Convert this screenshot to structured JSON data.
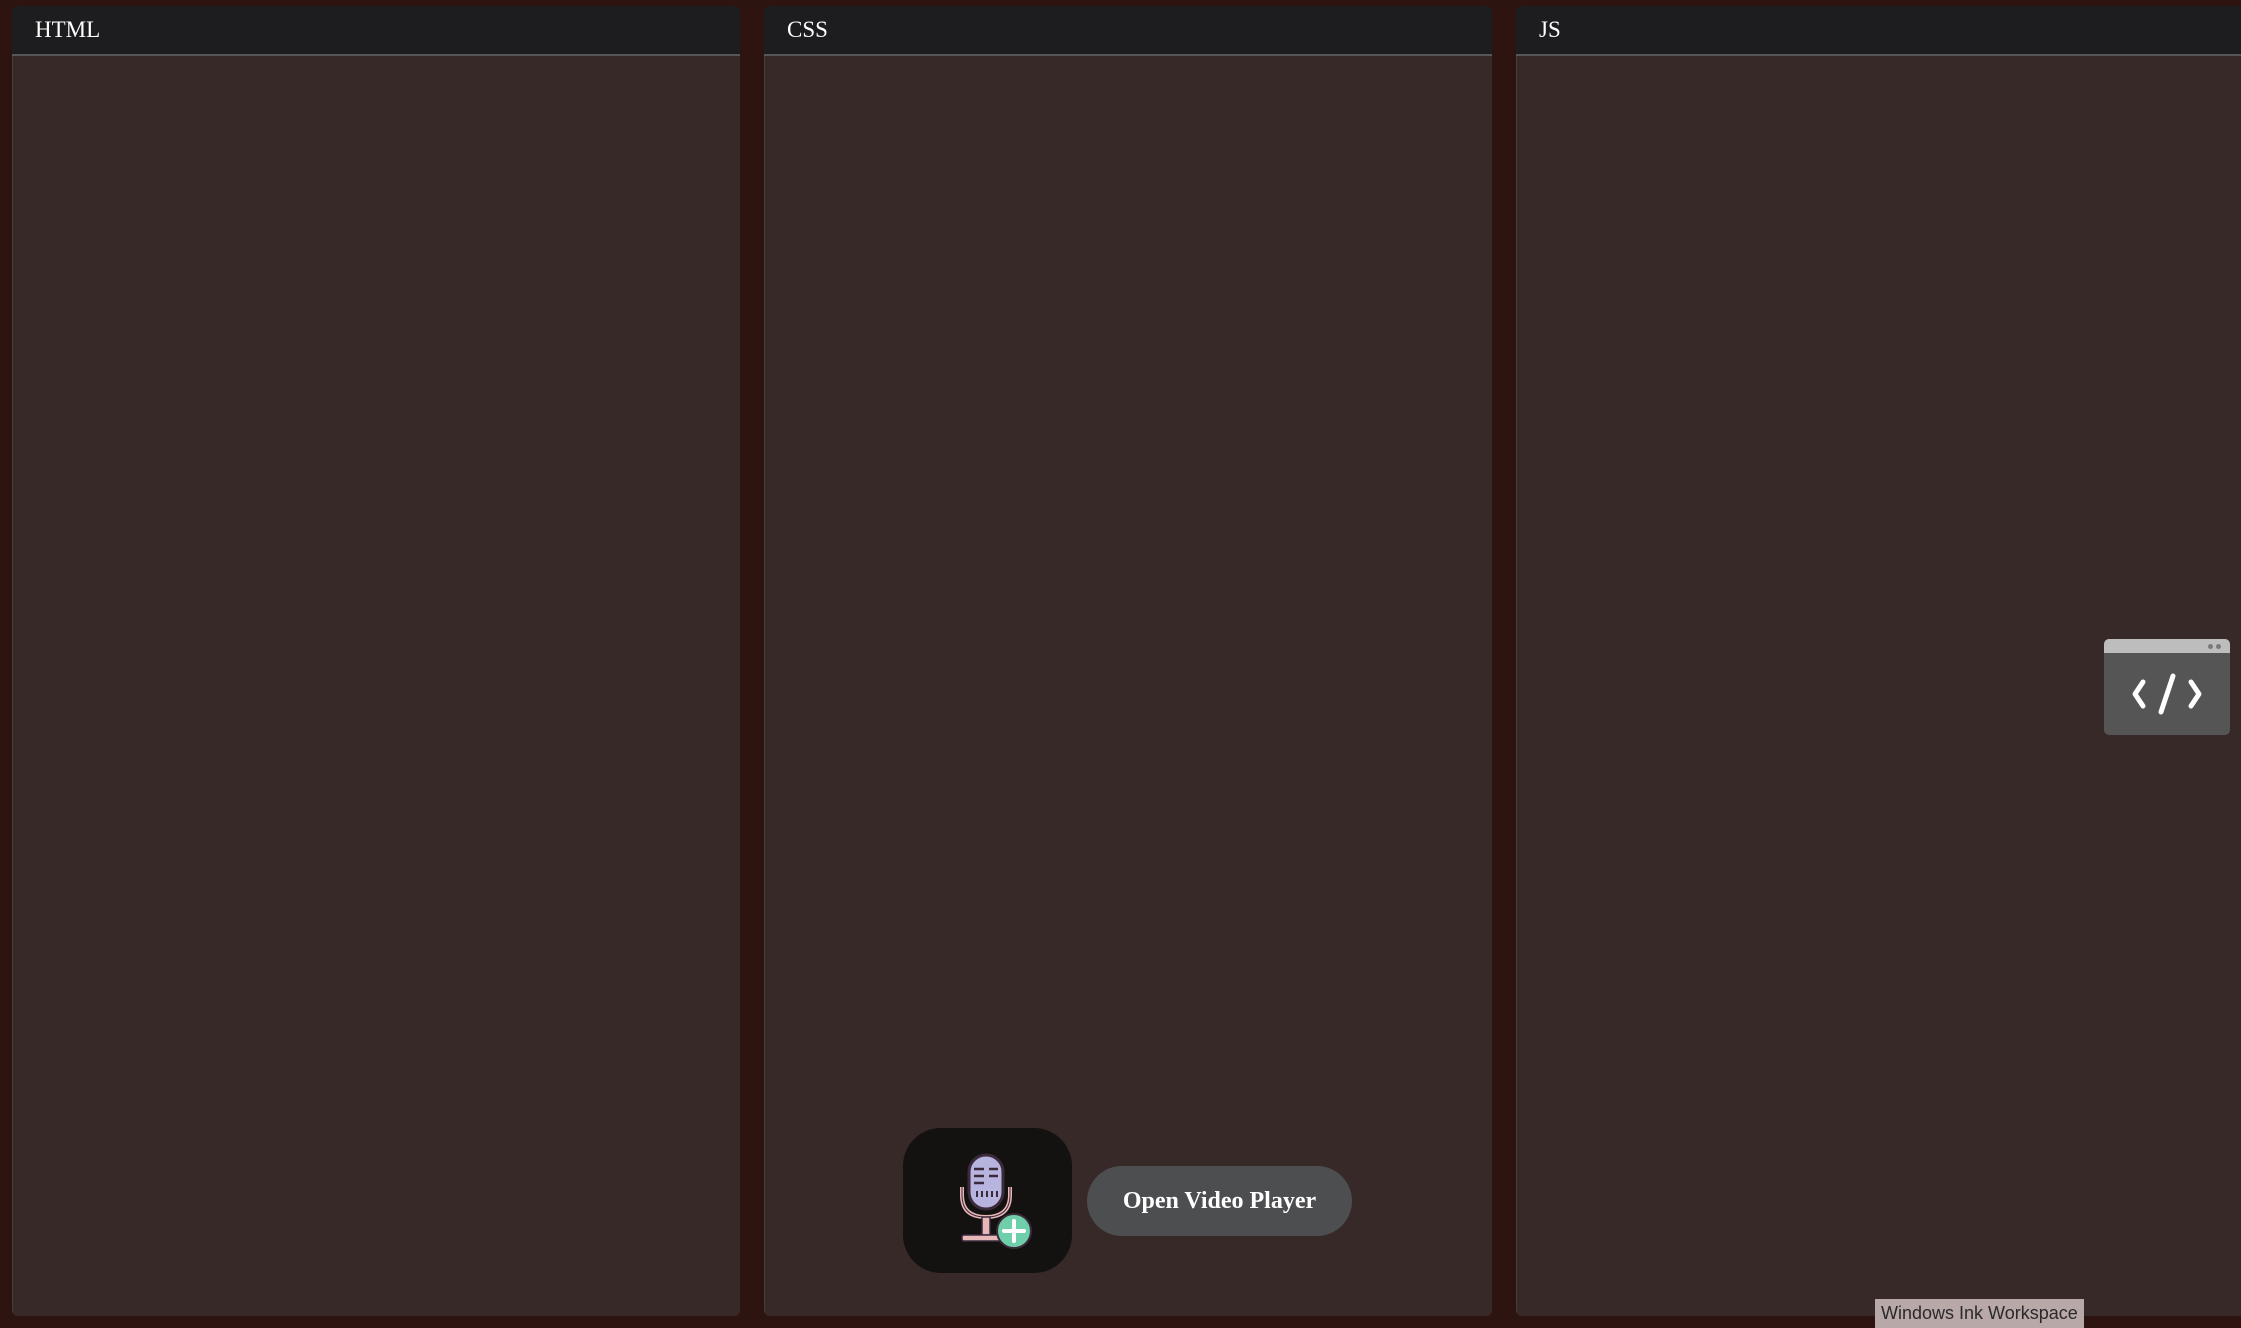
{
  "panels": {
    "html": {
      "title": "HTML"
    },
    "css": {
      "title": "CSS"
    },
    "js": {
      "title": "JS"
    }
  },
  "controls": {
    "mic_icon": "microphone-add-icon",
    "video_player_label": "Open Video Player"
  },
  "widget": {
    "icon": "code-brackets-icon"
  },
  "tooltip": {
    "text": "Windows Ink Workspace"
  },
  "colors": {
    "background": "#2e1410",
    "panel_body": "#372927",
    "panel_header": "#1d1d1f",
    "button": "#4d4e50",
    "mic_tile": "#141111",
    "mic_accent": "#b8b4e0",
    "plus_badge": "#6fcfaa"
  }
}
